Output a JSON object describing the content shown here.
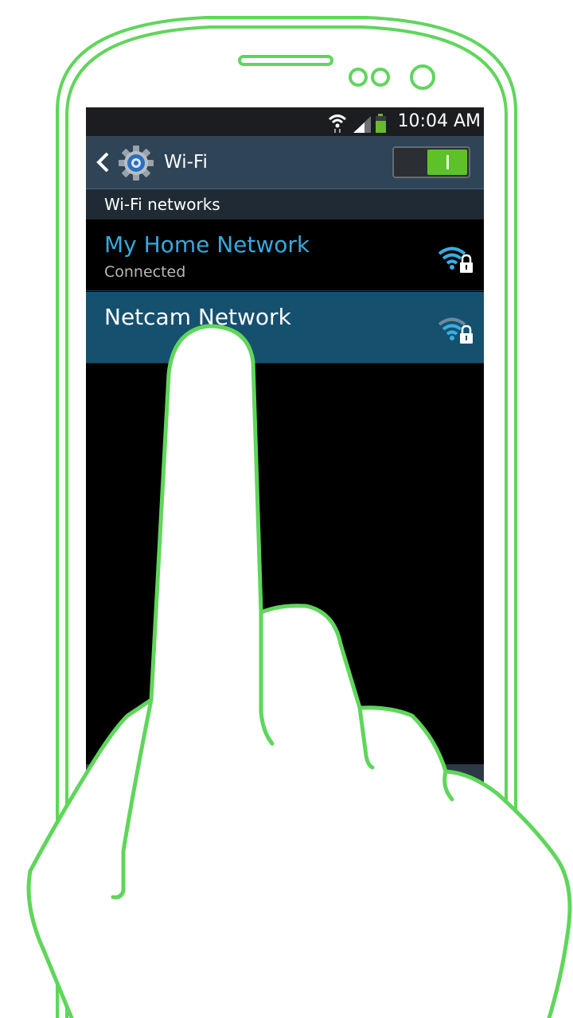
{
  "status_bar": {
    "time": "10:04 AM",
    "icons": [
      "wifi-icon",
      "signal-icon",
      "battery-icon"
    ],
    "battery_color": "#6ab82f"
  },
  "action_bar": {
    "back_icon": "chevron-left-icon",
    "settings_icon": "gear-icon",
    "title": "Wi-Fi",
    "toggle_state": "on",
    "toggle_color": "#5ec12a"
  },
  "section": {
    "header": "Wi-Fi networks"
  },
  "networks": [
    {
      "name": "My Home Network",
      "status": "Connected",
      "icon": "wifi-lock-icon",
      "name_color": "#36a9dc",
      "selected": false
    },
    {
      "name": "Netcam Network",
      "icon": "wifi-lock-icon",
      "name_color": "#ffffff",
      "selected": true
    }
  ],
  "illustration": {
    "outline_color": "#5fd65b",
    "objects": [
      "phone-outline",
      "pointing-hand"
    ]
  }
}
